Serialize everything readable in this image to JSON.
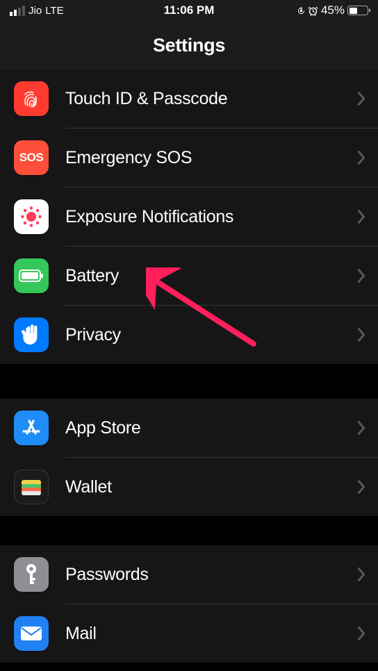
{
  "status": {
    "carrier": "Jio",
    "network": "LTE",
    "time": "11:06 PM",
    "battery_percent": "45%"
  },
  "header": {
    "title": "Settings"
  },
  "sections": [
    {
      "id": "a",
      "rows": [
        {
          "id": "touchid",
          "label": "Touch ID & Passcode"
        },
        {
          "id": "sos",
          "label": "Emergency SOS"
        },
        {
          "id": "exposure",
          "label": "Exposure Notifications"
        },
        {
          "id": "battery",
          "label": "Battery"
        },
        {
          "id": "privacy",
          "label": "Privacy"
        }
      ]
    },
    {
      "id": "b",
      "rows": [
        {
          "id": "appstore",
          "label": "App Store"
        },
        {
          "id": "wallet",
          "label": "Wallet"
        }
      ]
    },
    {
      "id": "c",
      "rows": [
        {
          "id": "passwords",
          "label": "Passwords"
        },
        {
          "id": "mail",
          "label": "Mail"
        }
      ]
    }
  ],
  "icons": {
    "sos_text": "SOS"
  }
}
